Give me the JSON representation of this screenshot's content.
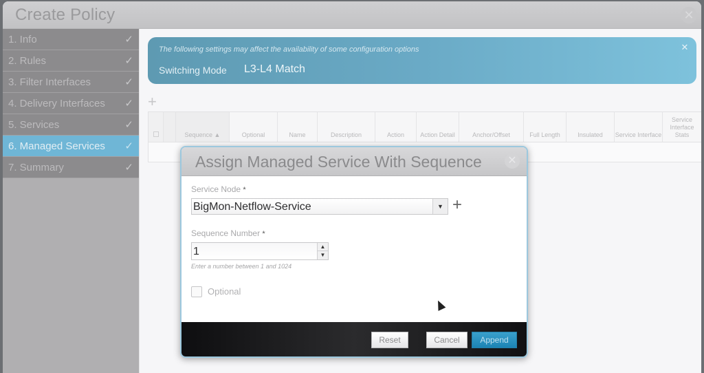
{
  "window": {
    "title": "Create Policy",
    "close_icon": "close-circle-icon"
  },
  "sidebar": {
    "steps": [
      {
        "label": "1. Info",
        "done": true
      },
      {
        "label": "2. Rules",
        "done": true
      },
      {
        "label": "3. Filter Interfaces",
        "done": true
      },
      {
        "label": "4. Delivery Interfaces",
        "done": true
      },
      {
        "label": "5. Services",
        "done": true
      },
      {
        "label": "6. Managed Services",
        "done": true,
        "active": true
      },
      {
        "label": "7. Summary",
        "done": true
      }
    ],
    "check_glyph": "✓"
  },
  "banner": {
    "note": "The following settings may affect the availability of some configuration options",
    "mode_label": "Switching Mode",
    "mode_value": "L3-L4 Match",
    "close_glyph": "✕"
  },
  "grid": {
    "add_glyph": "+",
    "columns": [
      "Sequence ▲",
      "Optional",
      "Name",
      "Description",
      "Action",
      "Action Detail",
      "Anchor/Offset",
      "Full Length",
      "Insulated",
      "Service Interface",
      "Service Interface Stats"
    ]
  },
  "dialog": {
    "title": "Assign Managed Service With Sequence",
    "close_glyph": "✕",
    "service_node": {
      "label": "Service Node",
      "required": "*",
      "value": "BigMon-Netflow-Service",
      "arrow_glyph": "▼",
      "add_glyph": "+"
    },
    "sequence_number": {
      "label": "Sequence Number",
      "required": "*",
      "value": "1",
      "hint": "Enter a number between 1 and 1024",
      "up_glyph": "▲",
      "down_glyph": "▼"
    },
    "optional": {
      "label": "Optional",
      "checked": false
    },
    "buttons": {
      "reset": "Reset",
      "cancel": "Cancel",
      "append": "Append"
    }
  },
  "colors": {
    "accent": "#6fb6d6",
    "append_button": "#1c84b4",
    "banner": "#6aaac6"
  }
}
